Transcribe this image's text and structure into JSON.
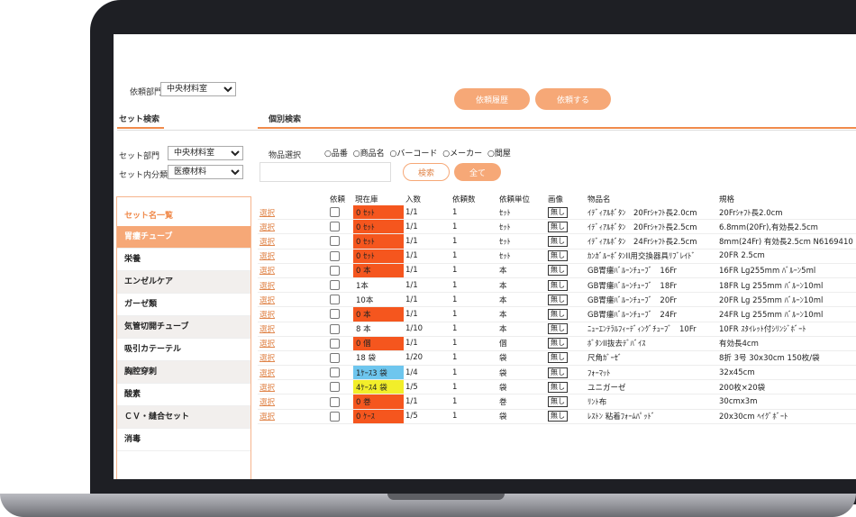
{
  "header": {
    "dept_label": "依頼部門",
    "dept_value": "中央材料室",
    "history_button": "依頼履歴",
    "request_button": "依頼する"
  },
  "tabs": {
    "set_search": "セット検索",
    "individual_search": "個別検索"
  },
  "set_filters": {
    "dept_label": "セット部門",
    "dept_value": "中央材料室",
    "category_label": "セット内分類",
    "category_value": "医療材料"
  },
  "item_filter": {
    "label": "物品選択",
    "options": [
      "品番",
      "商品名",
      "バーコード",
      "メーカー",
      "間屋"
    ],
    "search_button": "検索",
    "all_button": "全て"
  },
  "sidebar": {
    "header": "セット名一覧",
    "items": [
      "胃瘻チューブ",
      "栄養",
      "エンゼルケア",
      "ガーゼ類",
      "気管切開チューブ",
      "吸引カテーテル",
      "胸腔穿刺",
      "酸素",
      "ＣＶ・縫合セット",
      "消毒"
    ]
  },
  "table": {
    "columns": [
      "",
      "依頼",
      "現在庫",
      "入数",
      "依頼数",
      "依頼単位",
      "画像",
      "物品名",
      "規格"
    ],
    "select_label": "選択",
    "image_label": "無し",
    "rows": [
      {
        "stock": "0 ｾｯﾄ",
        "qty": "1/1",
        "req": "1",
        "unit": "ｾｯﾄ",
        "name": "ｲﾃﾞｨｱﾙﾎﾞﾀﾝ　20Frｼｬﾌﾄ長2.0cm",
        "spec": "20Frｼｬﾌﾄ長2.0cm",
        "color": "#f5561e"
      },
      {
        "stock": "0 ｾｯﾄ",
        "qty": "1/1",
        "req": "1",
        "unit": "ｾｯﾄ",
        "name": "ｲﾃﾞｨｱﾙﾎﾞﾀﾝ　20Frｼｬﾌﾄ長2.5cm",
        "spec": "6.8mm(20Fr),有効長2.5cm",
        "color": "#f5561e"
      },
      {
        "stock": "0 ｾｯﾄ",
        "qty": "1/1",
        "req": "1",
        "unit": "ｾｯﾄ",
        "name": "ｲﾃﾞｨｱﾙﾎﾞﾀﾝ　24Frｼｬﾌﾄ長2.5cm",
        "spec": "8mm(24Fr) 有効長2.5cm N6169410",
        "color": "#f5561e"
      },
      {
        "stock": "0 ｾｯﾄ",
        "qty": "1/1",
        "req": "1",
        "unit": "ｾｯﾄ",
        "name": "ｶﾝｶﾞﾙｰﾎﾞﾀﾝII用交換器具ﾘﾌﾞﾚｲﾄﾞ",
        "spec": "20FR 2.5cm",
        "color": "#f5561e"
      },
      {
        "stock": "0 本",
        "qty": "1/1",
        "req": "1",
        "unit": "本",
        "name": "GB胃瘻ﾊﾞﾙｰﾝﾁｭｰﾌﾞ　16Fr",
        "spec": "16FR Lg255mm ﾊﾞﾙｰﾝ5ml",
        "color": "#f5561e"
      },
      {
        "stock": "1本",
        "qty": "1/1",
        "req": "1",
        "unit": "本",
        "name": "GB胃瘻ﾊﾞﾙｰﾝﾁｭｰﾌﾞ　18Fr",
        "spec": "18FR Lg 255mm ﾊﾞﾙｰﾝ10ml",
        "color": ""
      },
      {
        "stock": "10本",
        "qty": "1/1",
        "req": "1",
        "unit": "本",
        "name": "GB胃瘻ﾊﾞﾙｰﾝﾁｭｰﾌﾞ　20Fr",
        "spec": "20FR Lg 255mm ﾊﾞﾙｰﾝ10ml",
        "color": ""
      },
      {
        "stock": "0 本",
        "qty": "1/1",
        "req": "1",
        "unit": "本",
        "name": "GB胃瘻ﾊﾞﾙｰﾝﾁｭｰﾌﾞ　24Fr",
        "spec": "24FR Lg 255mm ﾊﾞﾙｰﾝ10ml",
        "color": "#f5561e"
      },
      {
        "stock": "8 本",
        "qty": "1/10",
        "req": "1",
        "unit": "本",
        "name": "ﾆｭｰｴﾝﾃﾗﾙﾌｨｰﾃﾞｨﾝｸﾞﾁｭｰﾌﾞ　10Fr",
        "spec": "10FR ｽﾀｲﾚｯﾄ付ｼﾘﾝｼﾞﾎﾞｰﾄ",
        "color": ""
      },
      {
        "stock": "0 個",
        "qty": "1/1",
        "req": "1",
        "unit": "個",
        "name": "ﾎﾞﾀﾝII抜去ﾃﾞﾊﾞｲｽ",
        "spec": "有効長4cm",
        "color": "#f5561e"
      },
      {
        "stock": "18 袋",
        "qty": "1/20",
        "req": "1",
        "unit": "袋",
        "name": "尺角ｶﾞｰｾﾞ",
        "spec": "8折 3号 30x30cm 150枚/袋",
        "color": ""
      },
      {
        "stock": "1ｹｰｽ3 袋",
        "qty": "1/4",
        "req": "1",
        "unit": "袋",
        "name": "ﾌｫｰﾏｯﾄ",
        "spec": "32x45cm",
        "color": "#6ec6ee"
      },
      {
        "stock": "4ｹｰｽ4 袋",
        "qty": "1/5",
        "req": "1",
        "unit": "袋",
        "name": "ユニガーゼ",
        "spec": "200枚×20袋",
        "color": "#f2ee2a"
      },
      {
        "stock": "0 巻",
        "qty": "1/1",
        "req": "1",
        "unit": "巻",
        "name": "ﾘﾝﾄ布",
        "spec": "30cmx3m",
        "color": "#f5561e"
      },
      {
        "stock": "0 ｹｰｽ",
        "qty": "1/5",
        "req": "1",
        "unit": "袋",
        "name": "ﾚｽﾄﾝ 粘着ﾌｫｰﾑﾊﾟｯﾄﾞ",
        "spec": "20x30cm ﾍｲｸﾞﾎﾞｰﾄ",
        "color": "#f5561e"
      }
    ]
  },
  "colors": {
    "accent": "#f6a877",
    "stock_empty": "#f5561e",
    "stock_low": "#6ec6ee",
    "stock_warn": "#f2ee2a"
  }
}
